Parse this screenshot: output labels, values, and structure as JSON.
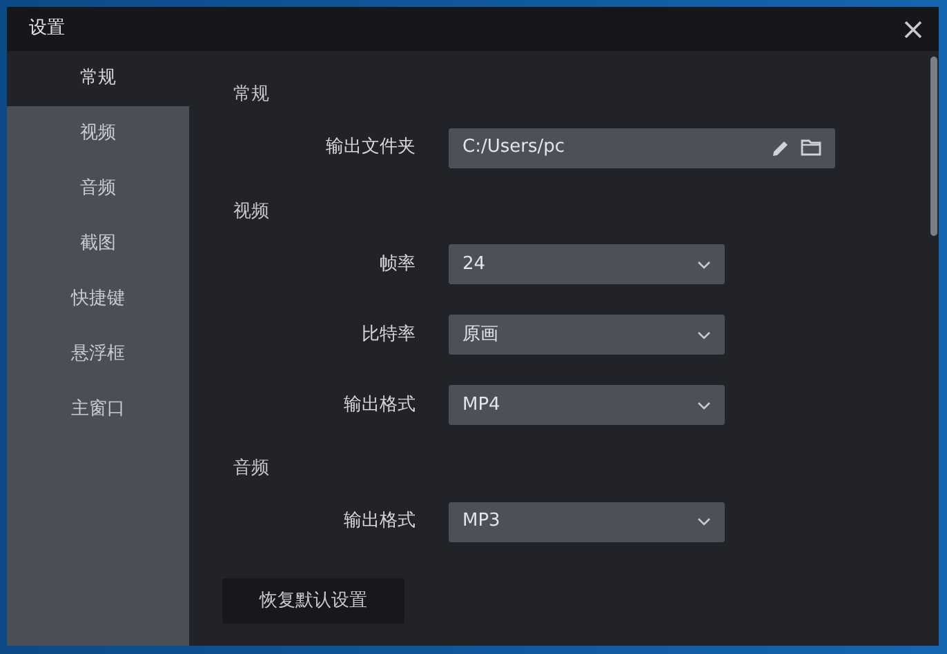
{
  "window": {
    "title": "设置"
  },
  "sidebar": {
    "items": [
      {
        "label": "常规",
        "selected": true
      },
      {
        "label": "视频",
        "selected": false
      },
      {
        "label": "音频",
        "selected": false
      },
      {
        "label": "截图",
        "selected": false
      },
      {
        "label": "快捷键",
        "selected": false
      },
      {
        "label": "悬浮框",
        "selected": false
      },
      {
        "label": "主窗口",
        "selected": false
      }
    ]
  },
  "sections": [
    {
      "title": "常规",
      "rows": [
        {
          "label": "输出文件夹",
          "kind": "path",
          "value": "C:/Users/pc"
        }
      ]
    },
    {
      "title": "视频",
      "rows": [
        {
          "label": "帧率",
          "kind": "select",
          "value": "24"
        },
        {
          "label": "比特率",
          "kind": "select",
          "value": "原画"
        },
        {
          "label": "输出格式",
          "kind": "select",
          "value": "MP4"
        }
      ]
    },
    {
      "title": "音频",
      "rows": [
        {
          "label": "输出格式",
          "kind": "select",
          "value": "MP3"
        }
      ]
    }
  ],
  "reset_button": "恢复默认设置"
}
